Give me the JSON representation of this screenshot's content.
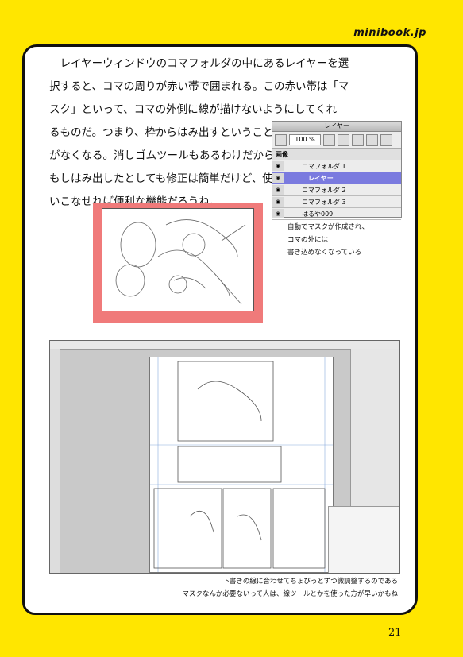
{
  "header": {
    "brand": "minibook.jp"
  },
  "body": {
    "paragraph": [
      "　レイヤーウィンドウのコマフォルダの中にあるレイヤーを選",
      "択すると、コマの周りが赤い帯で囲まれる。この赤い帯は「マ",
      "スク」といって、コマの外側に線が描けないようにしてくれ",
      "るものだ。つまり、枠からはみ出すということ",
      "がなくなる。消しゴムツールもあるわけだから、",
      "もしはみ出したとしても修正は簡単だけど、使",
      "いこなせれば便利な機能だろうね。"
    ]
  },
  "layer_panel": {
    "title": "レイヤー",
    "opacity": "100 %",
    "rows": [
      {
        "label": "画像",
        "selected": false
      },
      {
        "label": "コマフォルダ 1",
        "selected": false
      },
      {
        "label": "レイヤー",
        "selected": true
      },
      {
        "label": "コマフォルダ 2",
        "selected": false
      },
      {
        "label": "コマフォルダ 3",
        "selected": false
      },
      {
        "label": "はるや009",
        "selected": false
      }
    ]
  },
  "caption_top": [
    "自動でマスクが作成され、",
    "コマの外には",
    "書き込めなくなっている"
  ],
  "caption_bottom": [
    "下書きの線に合わせてちょびっとずつ微調整するのである",
    "マスクなんか必要ないって人は、線ツールとかを使った方が早いかもね"
  ],
  "footer": {
    "page_number": "21"
  },
  "colors": {
    "background": "#ffe600",
    "mask": "#f07a7a",
    "selected_layer": "#7a7adf"
  }
}
